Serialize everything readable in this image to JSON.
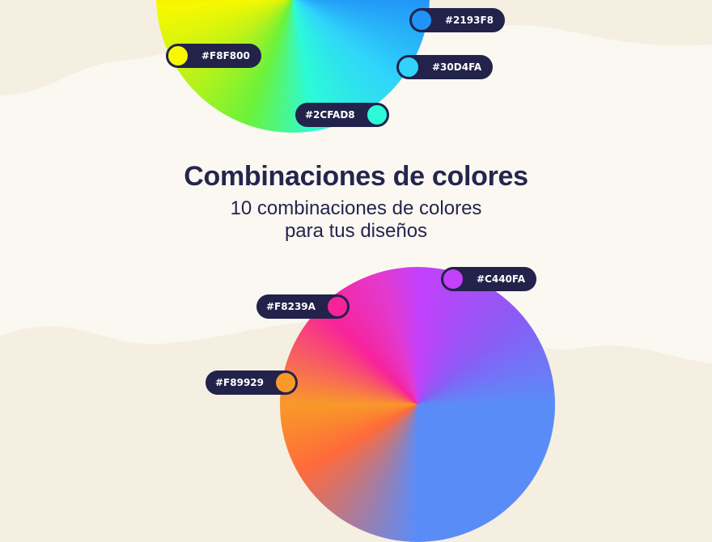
{
  "heading": {
    "title": "Combinaciones de colores",
    "subtitle_line1": "10 combinaciones de colores",
    "subtitle_line2": "para tus diseños"
  },
  "swatches_top": [
    {
      "label": "#2193F8",
      "color": "#2193F8"
    },
    {
      "label": "#F8F800",
      "color": "#F8F800"
    },
    {
      "label": "#30D4FA",
      "color": "#30D4FA"
    },
    {
      "label": "#2CFAD8",
      "color": "#2CFAD8"
    }
  ],
  "swatches_bottom": [
    {
      "label": "#C440FA",
      "color": "#C440FA"
    },
    {
      "label": "#F8239A",
      "color": "#F8239A"
    },
    {
      "label": "#F89929",
      "color": "#F89929"
    }
  ],
  "colors": {
    "background": "#F4EFE1",
    "wave": "#FAF8F1",
    "text": "#252550",
    "chip": "#22224A"
  }
}
